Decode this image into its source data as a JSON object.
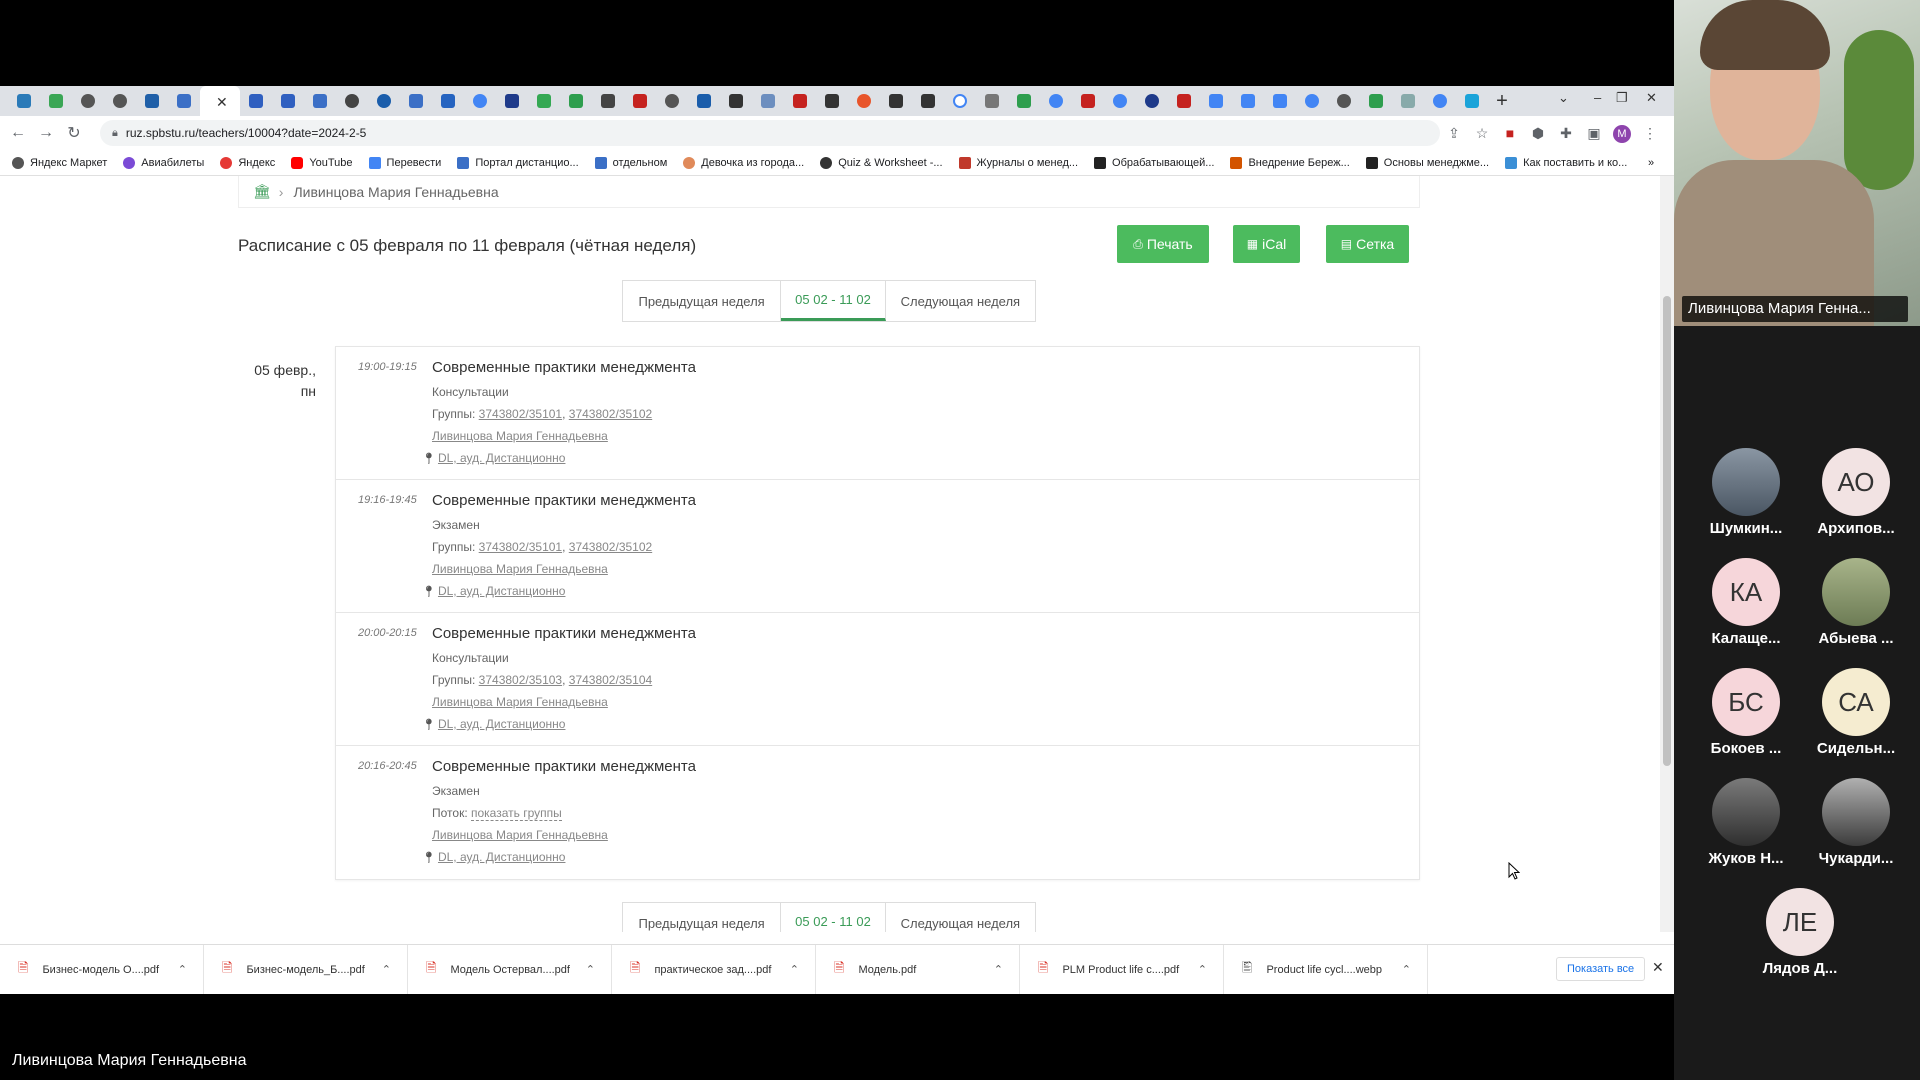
{
  "browser": {
    "url": "ruz.spbstu.ru/teachers/10004?date=2024-2-5",
    "bookmarks": [
      "Яндекс Маркет",
      "Авиабилеты",
      "Яндекс",
      "YouTube",
      "Перевести",
      "Портал дистанцио...",
      "отдельном",
      "Девочка из города...",
      "Quiz & Worksheet -...",
      "Журналы о менед...",
      "Обрабатывающей...",
      "Внедрение Береж...",
      "Основы менеджме...",
      "Как поставить и ко..."
    ],
    "more_bookmarks": "»",
    "profile_initial": "M"
  },
  "page": {
    "breadcrumb": "Ливинцова Мария Геннадьевна",
    "title": "Расписание с 05 февраля по 11 февраля (чётная неделя)",
    "buttons": {
      "print": "Печать",
      "ical": "iCal",
      "grid": "Сетка"
    },
    "week_nav": {
      "prev": "Предыдущая неделя",
      "current": "05 02 - 11 02",
      "next": "Следующая неделя"
    },
    "day": {
      "date": "05 февр.,",
      "weekday": "пн"
    },
    "lessons": [
      {
        "time": "19:00-19:15",
        "subject": "Современные практики менеджмента",
        "type": "Консультации",
        "groups_label": "Группы:",
        "groups": [
          "3743802/35101",
          "3743802/35102"
        ],
        "teacher": "Ливинцова Мария Геннадьевна",
        "place": "DL, ауд. Дистанционно"
      },
      {
        "time": "19:16-19:45",
        "subject": "Современные практики менеджмента",
        "type": "Экзамен",
        "groups_label": "Группы:",
        "groups": [
          "3743802/35101",
          "3743802/35102"
        ],
        "teacher": "Ливинцова Мария Геннадьевна",
        "place": "DL, ауд. Дистанционно"
      },
      {
        "time": "20:00-20:15",
        "subject": "Современные практики менеджмента",
        "type": "Консультации",
        "groups_label": "Группы:",
        "groups": [
          "3743802/35103",
          "3743802/35104"
        ],
        "teacher": "Ливинцова Мария Геннадьевна",
        "place": "DL, ауд. Дистанционно"
      },
      {
        "time": "20:16-20:45",
        "subject": "Современные практики менеджмента",
        "type": "Экзамен",
        "stream_label": "Поток:",
        "stream_link": "показать группы",
        "teacher": "Ливинцова Мария Геннадьевна",
        "place": "DL, ауд. Дистанционно"
      }
    ]
  },
  "downloads": {
    "items": [
      "Бизнес-модель О....pdf",
      "Бизнес-модель_Б....pdf",
      "Модель Остервал....pdf",
      "практическое зад....pdf",
      "Модель.pdf",
      "PLM Product life c....pdf",
      "Product life cycl....webp"
    ],
    "show_all": "Показать все"
  },
  "call": {
    "speaker_name": "Ливинцова Мария Генна...",
    "participants": [
      {
        "initials": "",
        "name": "Шумкин...",
        "color": ""
      },
      {
        "initials": "АО",
        "name": "Архипов...",
        "color": "#f2e3e3"
      },
      {
        "initials": "КА",
        "name": "Калаще...",
        "color": "#f6d6da"
      },
      {
        "initials": "",
        "name": "Абыева ...",
        "color": ""
      },
      {
        "initials": "БС",
        "name": "Бокоев ...",
        "color": "#f6d6da"
      },
      {
        "initials": "СА",
        "name": "Сидельн...",
        "color": "#f5ecd0"
      },
      {
        "initials": "",
        "name": "Жуков Н...",
        "color": ""
      },
      {
        "initials": "",
        "name": "Чукарди...",
        "color": ""
      },
      {
        "initials": "ЛЕ",
        "name": "Лядов Д...",
        "color": "#f2e3e3"
      }
    ],
    "bottom_name": "Ливинцова Мария Геннадьевна"
  },
  "colors": {
    "accent_green": "#4cbb5e",
    "link_green": "#3a9b57"
  }
}
